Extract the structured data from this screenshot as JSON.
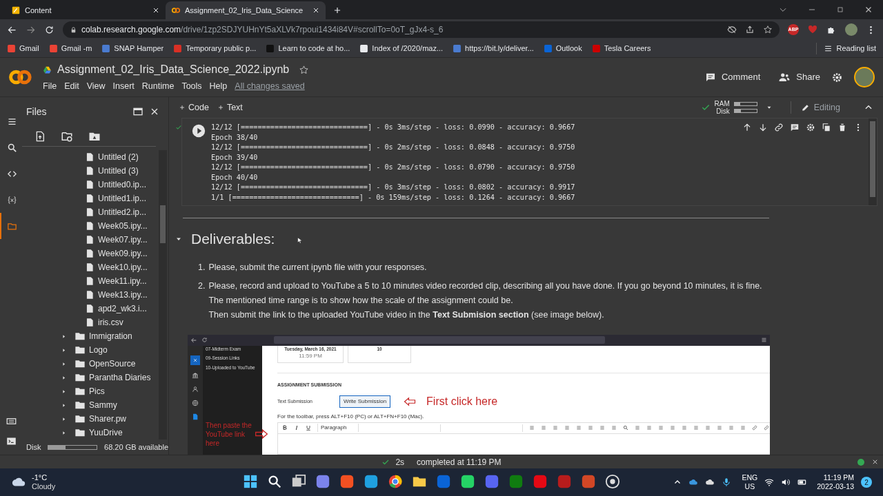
{
  "browser": {
    "tabs": [
      {
        "title": "Content",
        "selected": false,
        "kind": "doc"
      },
      {
        "title": "Assignment_02_Iris_Data_Science",
        "selected": true,
        "kind": "colab"
      }
    ],
    "url_host": "colab.research.google.com",
    "url_path": "/drive/1zp2SDJYUHnYt5aXLVk7rpoui1434i84V#scrollTo=0oT_gJx4-s_6",
    "extensions": [
      {
        "label": "ABP",
        "color": "#c62828"
      }
    ],
    "bookmarks": [
      {
        "label": "Gmail",
        "color": "#ea4335"
      },
      {
        "label": "Gmail -m",
        "color": "#ea4335"
      },
      {
        "label": "SNAP Hamper",
        "color": "#4a7bd0"
      },
      {
        "label": "Temporary public p...",
        "color": "#d93025"
      },
      {
        "label": "Learn to code at ho...",
        "color": "#111111"
      },
      {
        "label": "Index of /2020/maz...",
        "color": "#e8eaed"
      },
      {
        "label": "https://bit.ly/deliver...",
        "color": "#4a7bd0"
      },
      {
        "label": "Outlook",
        "color": "#0a64d6"
      },
      {
        "label": "Tesla Careers",
        "color": "#cc0000"
      }
    ],
    "reading_list": "Reading list"
  },
  "colab": {
    "title": "Assignment_02_Iris_Data_Science_2022.ipynb",
    "menu": [
      "File",
      "Edit",
      "View",
      "Insert",
      "Runtime",
      "Tools",
      "Help"
    ],
    "save_status": "All changes saved",
    "comment": "Comment",
    "share": "Share"
  },
  "toolbar": {
    "add_code": "Code",
    "add_text": "Text",
    "ram": {
      "label": "RAM",
      "level": 0.25
    },
    "disk": {
      "label": "Disk",
      "level": 0.3
    },
    "mode": "Editing"
  },
  "sidebar": {
    "rail": [
      {
        "kind": "menu",
        "selected": false
      },
      {
        "kind": "search",
        "selected": false
      },
      {
        "kind": "code",
        "selected": false
      },
      {
        "kind": "variables",
        "selected": false
      },
      {
        "kind": "files",
        "selected": true
      }
    ],
    "title": "Files",
    "items": [
      {
        "kind": "file",
        "name": "Untitled (2)"
      },
      {
        "kind": "file",
        "name": "Untitled (3)"
      },
      {
        "kind": "file",
        "name": "Untitled0.ip..."
      },
      {
        "kind": "file",
        "name": "Untitled1.ip..."
      },
      {
        "kind": "file",
        "name": "Untitled2.ip..."
      },
      {
        "kind": "file",
        "name": "Week05.ipy..."
      },
      {
        "kind": "file",
        "name": "Week07.ipy..."
      },
      {
        "kind": "file",
        "name": "Week09.ipy..."
      },
      {
        "kind": "file",
        "name": "Week10.ipy..."
      },
      {
        "kind": "file",
        "name": "Week11.ipy..."
      },
      {
        "kind": "file",
        "name": "Week13.ipy..."
      },
      {
        "kind": "file",
        "name": "apd2_wk3.i..."
      },
      {
        "kind": "file",
        "name": "iris.csv"
      },
      {
        "kind": "folder",
        "name": "Immigration",
        "expanded": false
      },
      {
        "kind": "folder",
        "name": "Logo",
        "expanded": false
      },
      {
        "kind": "folder",
        "name": "OpenSource",
        "expanded": false
      },
      {
        "kind": "folder",
        "name": "Parantha Diaries",
        "expanded": false
      },
      {
        "kind": "folder",
        "name": "Pics",
        "expanded": false
      },
      {
        "kind": "folder",
        "name": "Sammy",
        "expanded": false
      },
      {
        "kind": "folder",
        "name": "Sharer.pw",
        "expanded": false
      },
      {
        "kind": "folder",
        "name": "YuuDrive",
        "expanded": false
      }
    ],
    "disk": {
      "label": "Disk",
      "level": 0.35,
      "available": "68.20 GB available"
    }
  },
  "output": {
    "lines": [
      "12/12 [==============================] - 0s 3ms/step - loss: 0.0990 - accuracy: 0.9667",
      "Epoch 38/40",
      "12/12 [==============================] - 0s 2ms/step - loss: 0.0848 - accuracy: 0.9750",
      "Epoch 39/40",
      "12/12 [==============================] - 0s 2ms/step - loss: 0.0790 - accuracy: 0.9750",
      "Epoch 40/40",
      "12/12 [==============================] - 0s 3ms/step - loss: 0.0802 - accuracy: 0.9917",
      "1/1 [==============================] - 0s 159ms/step - loss: 0.1264 - accuracy: 0.9667"
    ]
  },
  "markdown": {
    "heading": "Deliverables:",
    "expanded": true,
    "items": [
      {
        "marker": "1.",
        "paragraphs": [
          "Please, submit the current ipynb file with your responses."
        ]
      },
      {
        "marker": "2.",
        "paragraphs": [
          "Please, record and upload to YouTube a 5 to 10 minutes video recorded clip, describing all you have done. If you go beyond 10 minutes, it is fine. The mentioned time range is to show how the scale of the assignment could be.",
          "Then submit the link to the uploaded YouTube video in the **Text Submision section** (see image below)."
        ]
      }
    ],
    "image": {
      "menu": [
        "07-Midterm Exam",
        "09-Session Links",
        "10-Uploaded to YouTube"
      ],
      "due_date": "Tuesday, March 16, 2021",
      "due_time": "11:59 PM",
      "points": "10",
      "section": "ASSIGNMENT SUBMISSION",
      "field_label": "Text Submission",
      "button": "Write Submission",
      "callout_1": "First click here",
      "toolbar_hint": "For the toolbar, press ALT+F10 (PC) or ALT+FN+F10 (Mac).",
      "style_select": "Paragraph",
      "callout_2": "Then paste the YouTube link here"
    }
  },
  "status_bar": {
    "duration": "2s",
    "message": "completed at 11:19 PM"
  },
  "taskbar": {
    "temperature": "-1°C",
    "weather": "Cloudy",
    "apps": [
      {
        "kind": "start",
        "color": "#4cc2ff"
      },
      {
        "kind": "search",
        "color": "#ffffff"
      },
      {
        "kind": "task",
        "color": "#cccccc"
      },
      {
        "kind": "chat",
        "color": "#7b83eb"
      },
      {
        "kind": "store",
        "color": "#f25022"
      },
      {
        "kind": "edge",
        "color": "#1fa0e0"
      },
      {
        "kind": "chrome"
      },
      {
        "kind": "explorer",
        "color": "#f8c948"
      },
      {
        "kind": "outlook",
        "color": "#0a64d6"
      },
      {
        "kind": "whatsapp",
        "color": "#25d366"
      },
      {
        "kind": "discord",
        "color": "#5865f2"
      },
      {
        "kind": "xbox",
        "color": "#107c10"
      },
      {
        "kind": "netflix",
        "color": "#e50914"
      },
      {
        "kind": "app",
        "color": "#b71c1c"
      },
      {
        "kind": "powerpoint",
        "color": "#d24726"
      },
      {
        "kind": "obs",
        "color": "#dddddd"
      }
    ],
    "language": "ENG",
    "region": "US",
    "time": "11:19 PM",
    "date": "2022-03-13",
    "notifications": "2"
  }
}
